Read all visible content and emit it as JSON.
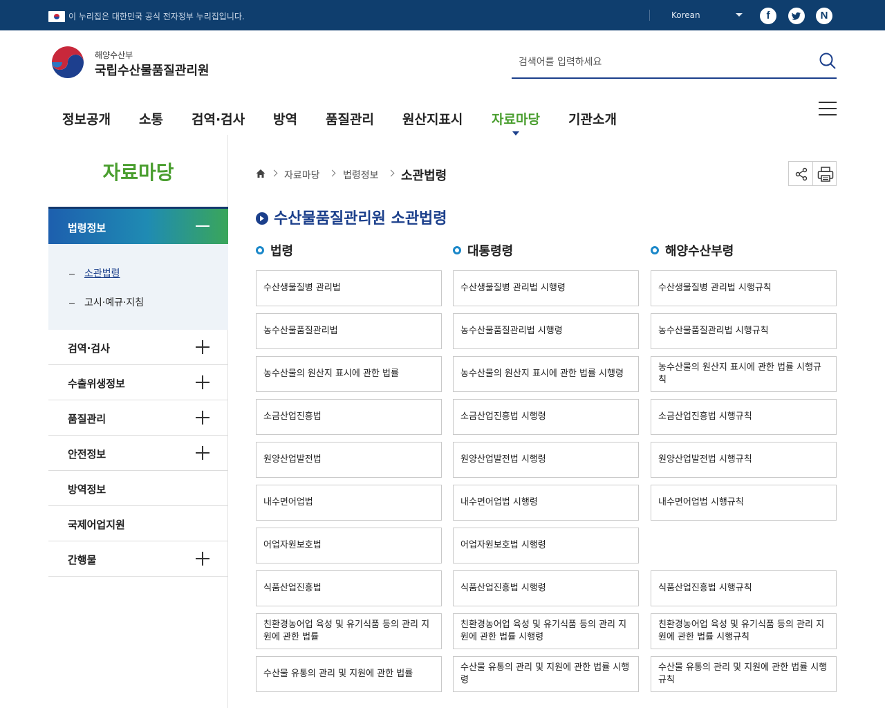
{
  "topbar": {
    "gov_notice": "이 누리집은 대한민국 공식 전자정부 누리집입니다.",
    "language": "Korean",
    "sns": {
      "facebook": "f",
      "twitter": "t",
      "naver": "N"
    }
  },
  "header": {
    "org_sub": "해양수산부",
    "org_name": "국립수산물품질관리원",
    "search_placeholder": "검색어를 입력하세요"
  },
  "gnb": [
    {
      "label": "정보공개"
    },
    {
      "label": "소통"
    },
    {
      "label": "검역·검사"
    },
    {
      "label": "방역"
    },
    {
      "label": "품질관리"
    },
    {
      "label": "원산지표시"
    },
    {
      "label": "자료마당"
    },
    {
      "label": "기관소개"
    }
  ],
  "sidebar": {
    "title": "자료마당",
    "active": "법령정보",
    "subitems": [
      "소관법령",
      "고시·예규·지침"
    ],
    "items": [
      "검역·검사",
      "수출위생정보",
      "품질관리",
      "안전정보",
      "방역정보",
      "국제어업지원",
      "간행물"
    ]
  },
  "breadcrumb": [
    "자료마당",
    "법령정보",
    "소관법령"
  ],
  "content": {
    "title": "수산물품질관리원 소관법령",
    "columns": [
      "법령",
      "대통령령",
      "해양수산부령"
    ],
    "laws": [
      [
        "수산생물질병 관리법",
        "수산생물질병 관리법 시행령",
        "수산생물질병 관리법 시행규칙"
      ],
      [
        "농수산물품질관리법",
        "농수산물품질관리법 시행령",
        "농수산물품질관리법 시행규칙"
      ],
      [
        "농수산물의 원산지 표시에 관한 법률",
        "농수산물의 원산지 표시에 관한 법률 시행령",
        "농수산물의 원산지 표시에 관한 법률 시행규칙"
      ],
      [
        "소금산업진흥법",
        "소금산업진흥법 시행령",
        "소금산업진흥법 시행규칙"
      ],
      [
        "원양산업발전법",
        "원양산업발전법 시행령",
        "원양산업발전법 시행규칙"
      ],
      [
        "내수면어업법",
        "내수면어업법 시행령",
        "내수면어업법 시행규칙"
      ],
      [
        "어업자원보호법",
        "어업자원보호법 시행령",
        ""
      ],
      [
        "식품산업진흥법",
        "식품산업진흥법 시행령",
        "식품산업진흥법 시행규칙"
      ],
      [
        "친환경농어업 육성 및 유기식품 등의 관리 지원에 관한 법률",
        "친환경농어업 육성 및 유기식품 등의 관리 지원에 관한 법률 시행령",
        "친환경농어업 육성 및 유기식품 등의 관리 지원에 관한 법률 시행규칙"
      ],
      [
        "수산물 유통의 관리 및 지원에 관한 법률",
        "수산물 유통의 관리 및 지원에 관한 법률 시행령",
        "수산물 유통의 관리 및 지원에 관한 법률 시행규칙"
      ]
    ]
  },
  "colors": {
    "topbar": "#0f3e6e",
    "accent_blue": "#1b3f8b",
    "accent_green": "#4a9e2f"
  }
}
